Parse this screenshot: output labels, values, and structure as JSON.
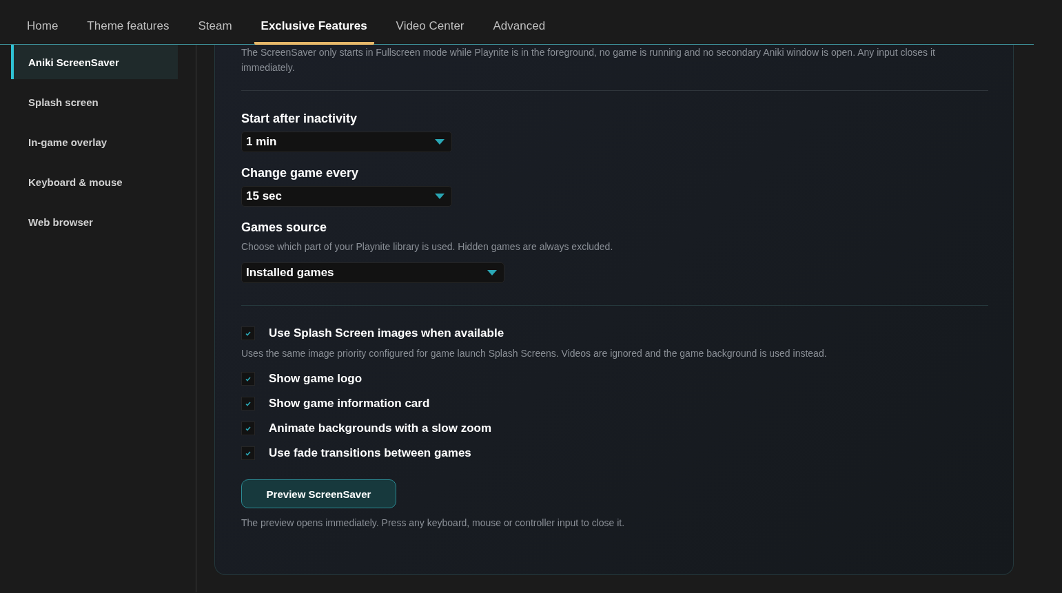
{
  "tabs": [
    {
      "label": "Home",
      "selected": false
    },
    {
      "label": "Theme features",
      "selected": false
    },
    {
      "label": "Steam",
      "selected": false
    },
    {
      "label": "Exclusive Features",
      "selected": true
    },
    {
      "label": "Video Center",
      "selected": false
    },
    {
      "label": "Advanced",
      "selected": false
    }
  ],
  "sidebar": {
    "items": [
      {
        "label": "Aniki ScreenSaver",
        "selected": true
      },
      {
        "label": "Splash screen",
        "selected": false
      },
      {
        "label": "In-game overlay",
        "selected": false
      },
      {
        "label": "Keyboard & mouse",
        "selected": false
      },
      {
        "label": "Web browser",
        "selected": false
      }
    ]
  },
  "intro": "The ScreenSaver only starts in Fullscreen mode while Playnite is in the foreground, no game is running and no secondary Aniki window is open. Any input closes it immediately.",
  "settings": [
    {
      "label": "Start after inactivity",
      "value": "1 min"
    },
    {
      "label": "Change game every",
      "value": "15 sec"
    },
    {
      "label": "Games source",
      "description": "Choose which part of your Playnite library is used. Hidden games are always excluded.",
      "value": "Installed games"
    }
  ],
  "options": [
    {
      "label": "Use Splash Screen images when available",
      "checked": true,
      "description": "Uses the same image priority configured for game launch Splash Screens. Videos are ignored and the game background is used instead."
    },
    {
      "label": "Show game logo",
      "checked": true
    },
    {
      "label": "Show game information card",
      "checked": true
    },
    {
      "label": "Animate backgrounds with a slow zoom",
      "checked": true
    },
    {
      "label": "Use fade transitions between games",
      "checked": true
    }
  ],
  "preview_button": "Preview ScreenSaver",
  "preview_note": "The preview opens immediately. Press any keyboard, mouse or controller input to close it."
}
